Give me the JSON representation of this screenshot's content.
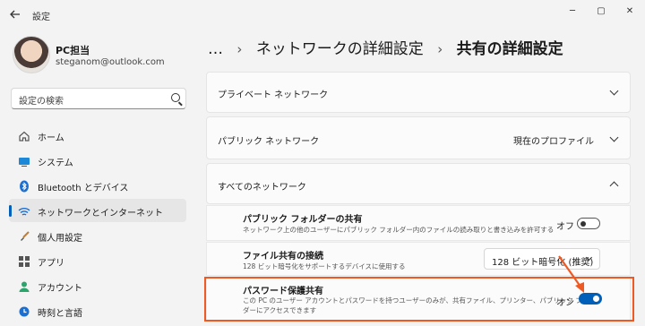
{
  "window": {
    "title": "設定",
    "back_icon": "arrow-left-icon",
    "minimize": "─",
    "maximize": "▢",
    "close": "✕"
  },
  "user": {
    "name": "PC担当",
    "email": "steganom@outlook.com"
  },
  "search": {
    "placeholder": "設定の検索"
  },
  "sidebar": {
    "items": [
      {
        "label": "ホーム",
        "icon": "home-icon"
      },
      {
        "label": "システム",
        "icon": "system-icon"
      },
      {
        "label": "Bluetooth とデバイス",
        "icon": "bluetooth-icon"
      },
      {
        "label": "ネットワークとインターネット",
        "icon": "wifi-icon",
        "active": true
      },
      {
        "label": "個人用設定",
        "icon": "brush-icon"
      },
      {
        "label": "アプリ",
        "icon": "apps-icon"
      },
      {
        "label": "アカウント",
        "icon": "account-icon"
      },
      {
        "label": "時刻と言語",
        "icon": "clock-globe-icon"
      }
    ]
  },
  "breadcrumb": {
    "ellipsis": "…",
    "sep": "›",
    "parent": "ネットワークの詳細設定",
    "current": "共有の詳細設定"
  },
  "sections": {
    "private": {
      "label": "プライベート ネットワーク"
    },
    "public": {
      "label": "パブリック ネットワーク",
      "status": "現在のプロファイル"
    },
    "all": {
      "label": "すべてのネットワーク",
      "public_folder": {
        "title": "パブリック フォルダーの共有",
        "desc": "ネットワーク上の他のユーザーにパブリック フォルダー内のファイルの読み取りと書き込みを許可する",
        "state": "オフ"
      },
      "file_sharing": {
        "title": "ファイル共有の接続",
        "desc": "128 ビット暗号化をサポートするデバイスに使用する",
        "value": "128 ビット暗号化 (推奨)"
      },
      "password": {
        "title": "パスワード保護共有",
        "desc1": "この PC のユーザー アカウントとパスワードを持つユーザーのみが、共有ファイル、プリンター、パブリック フォル",
        "desc2": "ダーにアクセスできます",
        "state": "オン"
      }
    }
  },
  "colors": {
    "accent": "#005fb8",
    "highlight": "#ef5a24"
  }
}
